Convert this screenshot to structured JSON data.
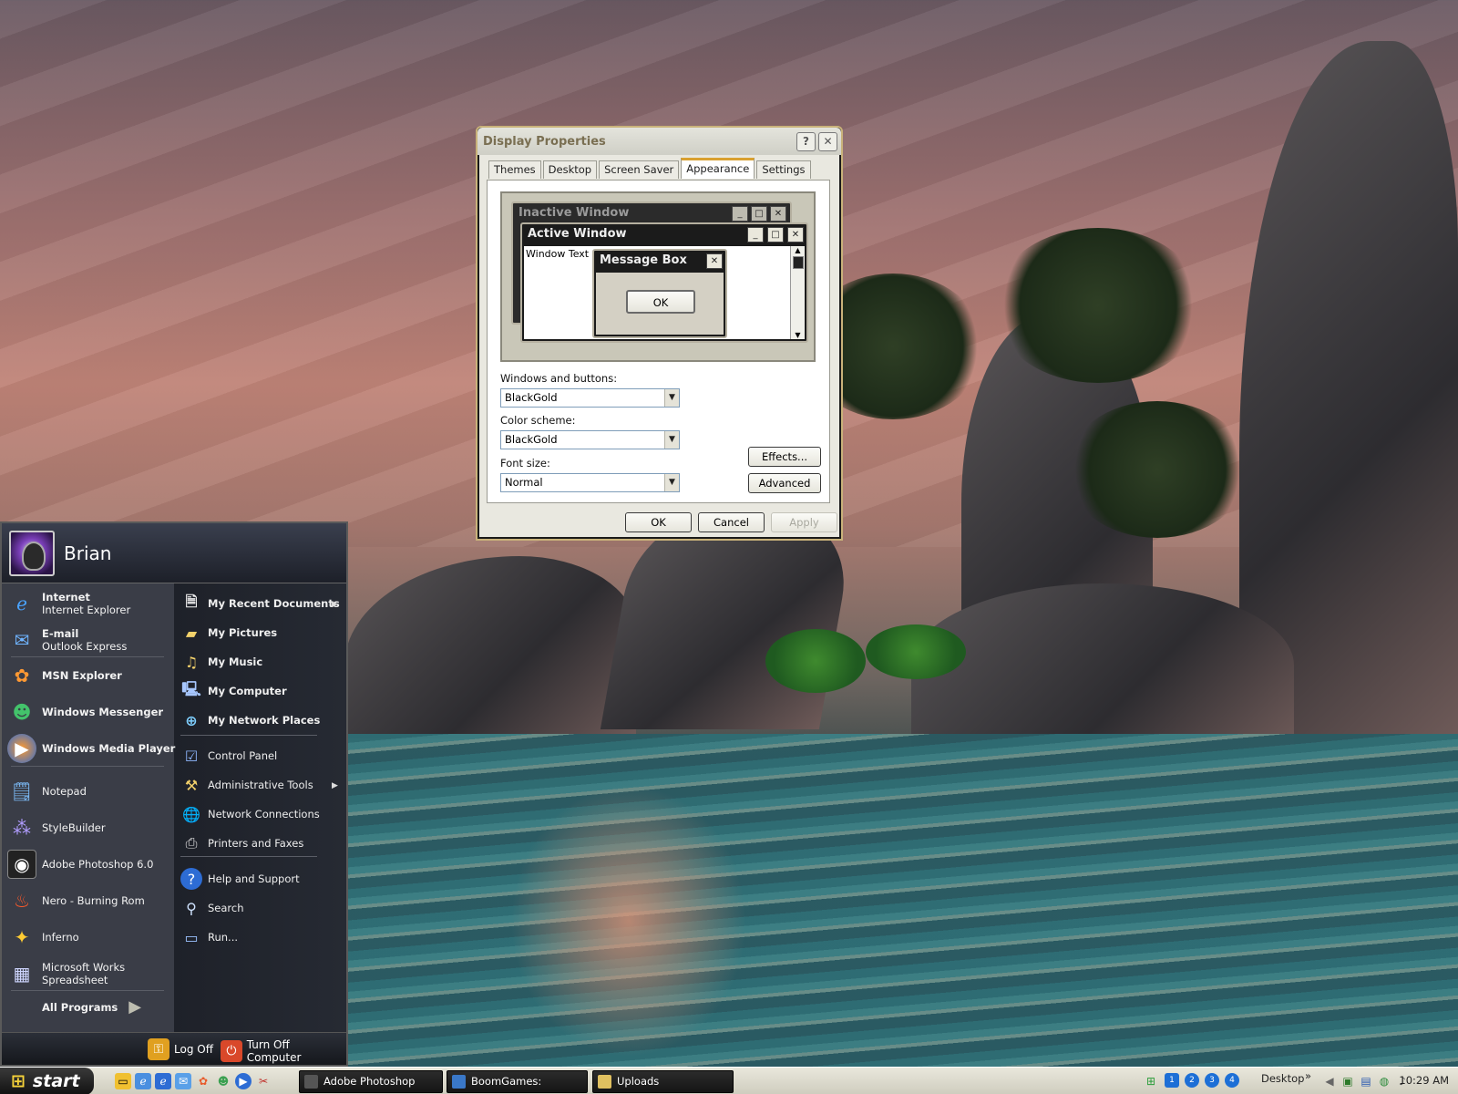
{
  "dialog": {
    "title": "Display Properties",
    "tabs": [
      "Themes",
      "Desktop",
      "Screen Saver",
      "Appearance",
      "Settings"
    ],
    "active_tab": "Appearance",
    "preview": {
      "inactive_title": "Inactive Window",
      "active_title": "Active Window",
      "window_text": "Window Text",
      "message_box_title": "Message Box",
      "message_box_ok": "OK"
    },
    "windows_and_buttons_label": "Windows and buttons:",
    "windows_and_buttons_value": "BlackGold",
    "color_scheme_label": "Color scheme:",
    "color_scheme_value": "BlackGold",
    "font_size_label": "Font size:",
    "font_size_value": "Normal",
    "effects_button": "Effects...",
    "advanced_button": "Advanced",
    "ok_button": "OK",
    "cancel_button": "Cancel",
    "apply_button": "Apply"
  },
  "start_menu": {
    "user": "Brian",
    "pinned": [
      {
        "title": "Internet",
        "subtitle": "Internet Explorer",
        "icon": "internet-explorer-icon"
      },
      {
        "title": "E-mail",
        "subtitle": "Outlook Express",
        "icon": "outlook-express-icon"
      }
    ],
    "recent": [
      {
        "label": "MSN Explorer",
        "icon": "msn-explorer-icon",
        "bold": true
      },
      {
        "label": "Windows Messenger",
        "icon": "windows-messenger-icon",
        "bold": true
      },
      {
        "label": "Windows Media Player",
        "icon": "windows-media-player-icon",
        "bold": true
      },
      {
        "label": "Notepad",
        "icon": "notepad-icon",
        "bold": false
      },
      {
        "label": "StyleBuilder",
        "icon": "stylebuilder-icon",
        "bold": false
      },
      {
        "label": "Adobe Photoshop 6.0",
        "icon": "photoshop-icon",
        "bold": false
      },
      {
        "label": "Nero - Burning Rom",
        "icon": "nero-icon",
        "bold": false
      },
      {
        "label": "Inferno",
        "icon": "inferno-icon",
        "bold": false
      }
    ],
    "works": {
      "line1": "Microsoft Works",
      "line2": "Spreadsheet"
    },
    "all_programs": "All Programs",
    "right": [
      {
        "label": "My Recent Documents",
        "icon": "recent-documents-icon"
      },
      {
        "label": "My Pictures",
        "icon": "pictures-folder-icon"
      },
      {
        "label": "My Music",
        "icon": "music-folder-icon"
      },
      {
        "label": "My Computer",
        "icon": "computer-icon"
      },
      {
        "label": "My Network Places",
        "icon": "network-places-icon"
      },
      {
        "label": "Control Panel",
        "icon": "control-panel-icon"
      },
      {
        "label": "Administrative Tools",
        "icon": "admin-tools-icon"
      },
      {
        "label": "Network Connections",
        "icon": "network-connections-icon"
      },
      {
        "label": "Printers and Faxes",
        "icon": "printer-icon"
      },
      {
        "label": "Help and Support",
        "icon": "help-icon"
      },
      {
        "label": "Search",
        "icon": "search-icon"
      },
      {
        "label": "Run...",
        "icon": "run-icon"
      }
    ],
    "log_off": "Log Off",
    "turn_off": "Turn Off Computer"
  },
  "taskbar": {
    "start": "start",
    "tasks": [
      "Adobe Photoshop",
      "BoomGames: Window...",
      "Uploads"
    ],
    "desktop_toolbar": "Desktop",
    "chevron": "»",
    "virtual_desktops": [
      "1",
      "2",
      "3",
      "4"
    ],
    "clock": "10:29 AM"
  }
}
